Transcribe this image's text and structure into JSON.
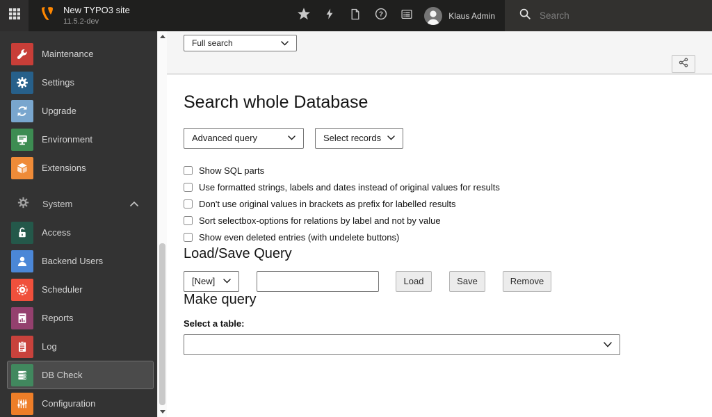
{
  "topbar": {
    "title": "New TYPO3 site",
    "version": "11.5.2-dev",
    "user_name": "Klaus Admin",
    "search_placeholder": "Search"
  },
  "sidebar": {
    "section_label": "System",
    "items": [
      {
        "label": "Maintenance",
        "color": "#c83e38",
        "icon": "wrench-icon"
      },
      {
        "label": "Settings",
        "color": "#27608a",
        "icon": "gear-icon"
      },
      {
        "label": "Upgrade",
        "color": "#79a6ce",
        "icon": "refresh-arrows-icon"
      },
      {
        "label": "Environment",
        "color": "#3d8c52",
        "icon": "monitor-icon"
      },
      {
        "label": "Extensions",
        "color": "#ef8b38",
        "icon": "cube-icon"
      },
      {
        "label": "Access",
        "color": "#24584a",
        "icon": "lock-icon"
      },
      {
        "label": "Backend Users",
        "color": "#4b87d7",
        "icon": "user-icon"
      },
      {
        "label": "Scheduler",
        "color": "#f0503c",
        "icon": "play-clock-icon"
      },
      {
        "label": "Reports",
        "color": "#94406e",
        "icon": "chart-document-icon"
      },
      {
        "label": "Log",
        "color": "#c8423c",
        "icon": "clipboard-icon"
      },
      {
        "label": "DB Check",
        "color": "#41885e",
        "icon": "server-stack-icon",
        "active": true
      },
      {
        "label": "Configuration",
        "color": "#ee7e28",
        "icon": "sliders-icon"
      }
    ]
  },
  "docheader": {
    "view_mode": "Full search"
  },
  "main": {
    "title": "Search whole Database",
    "query_type": "Advanced query",
    "records": "Select records",
    "options": [
      "Show SQL parts",
      "Use formatted strings, labels and dates instead of original values for results",
      "Don't use original values in brackets as prefix for labelled results",
      "Sort selectbox-options for relations by label and not by value",
      "Show even deleted entries (with undelete buttons)"
    ],
    "load_save": {
      "heading": "Load/Save Query",
      "preset": "[New]",
      "query_name": "",
      "load": "Load",
      "save": "Save",
      "remove": "Remove"
    },
    "make_query": {
      "heading": "Make query",
      "table_label": "Select a table:",
      "table_value": ""
    }
  },
  "colors": {
    "brand_orange": "#ff8700",
    "topbar_bg": "#1f1f1e",
    "sidebar_bg": "#333333",
    "active_item_bg": "#4b4b4b"
  }
}
